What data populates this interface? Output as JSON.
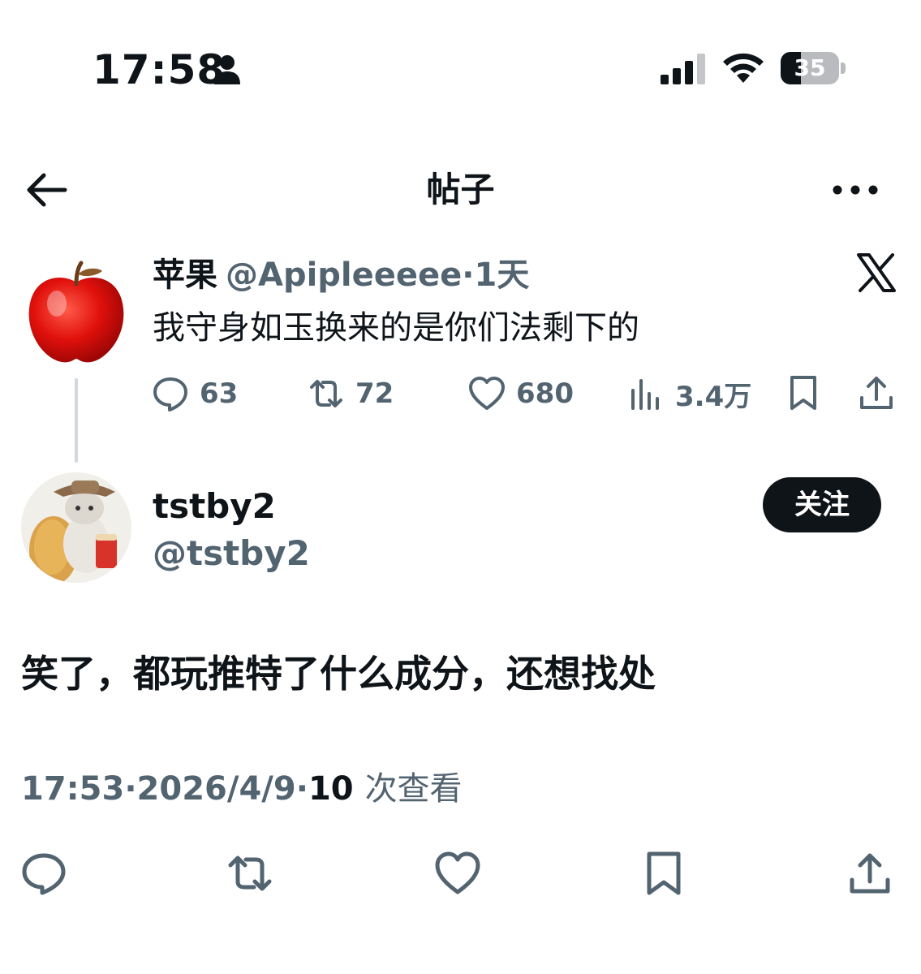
{
  "status_bar": {
    "time": "17:58",
    "battery_level": "35",
    "battery_fraction": 0.35
  },
  "header": {
    "title": "帖子",
    "back_icon": "arrow-left-icon",
    "more_icon": "more-horizontal-icon"
  },
  "parent_tweet": {
    "name": "苹果",
    "handle": "@Apipleeeee",
    "separator": "·",
    "time": "1天",
    "text": "我守身如玉换来的是你们法剩下的",
    "logo_icon": "x-logo-icon",
    "stats": {
      "replies": "63",
      "retweets": "72",
      "likes": "680",
      "views": "3.4万"
    }
  },
  "reply": {
    "name": "tstby2",
    "handle": "@tstby2",
    "follow_label": "关注",
    "text": "笑了，都玩推特了什么成分，还想找处",
    "time": "17:53",
    "separator": "·",
    "date": "2026/4/9",
    "views_count": "10",
    "views_label": "次查看"
  },
  "colors": {
    "text_primary": "#0f1419",
    "text_secondary": "#536471",
    "thread_line": "#cfd9de",
    "button_dark": "#0f1419"
  }
}
